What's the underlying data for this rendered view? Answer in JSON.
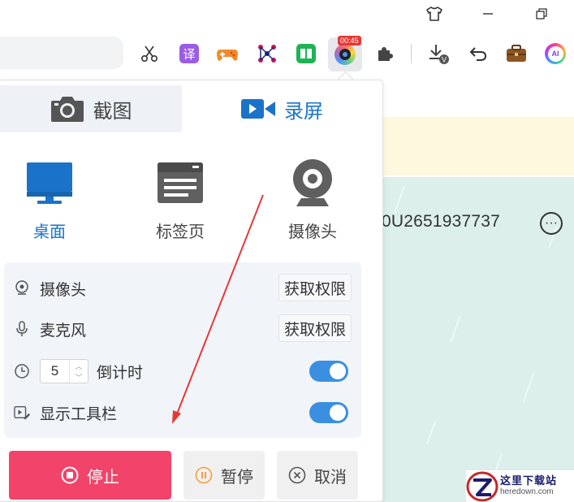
{
  "browser": {
    "window_controls": [
      "minimize",
      "restore"
    ],
    "extensions": [
      "scissors-icon",
      "translate-icon",
      "game-icon",
      "network-icon",
      "reader-icon",
      "screen-recorder-icon",
      "puzzle-icon",
      "download-icon",
      "undo-icon",
      "briefcase-icon",
      "ai-icon"
    ],
    "translate_label": "译",
    "ai_label": "AI",
    "recorder_badge": "00:45"
  },
  "page": {
    "account_id": "0U2651937737"
  },
  "popup": {
    "tabs": [
      {
        "label": "截图",
        "icon": "camera-icon"
      },
      {
        "label": "录屏",
        "icon": "video-icon",
        "active": true
      }
    ],
    "modes": [
      {
        "label": "桌面",
        "icon": "monitor-icon",
        "active": true
      },
      {
        "label": "标签页",
        "icon": "browser-tab-icon"
      },
      {
        "label": "摄像头",
        "icon": "webcam-icon"
      }
    ],
    "settings": {
      "camera": {
        "label": "摄像头",
        "button": "获取权限"
      },
      "microphone": {
        "label": "麦克风",
        "button": "获取权限"
      },
      "countdown": {
        "label": "倒计时",
        "value": "5",
        "enabled": true
      },
      "toolbar": {
        "label": "显示工具栏",
        "enabled": true
      }
    },
    "actions": {
      "stop": "停止",
      "pause": "暂停",
      "cancel": "取消"
    }
  },
  "watermark": {
    "cn": "这里下载站",
    "en": "heredown.com"
  },
  "colors": {
    "accent_blue": "#1a73c8",
    "toggle_on": "#3b8fe0",
    "stop_red": "#f2436a",
    "annotation_arrow": "#e53935"
  }
}
